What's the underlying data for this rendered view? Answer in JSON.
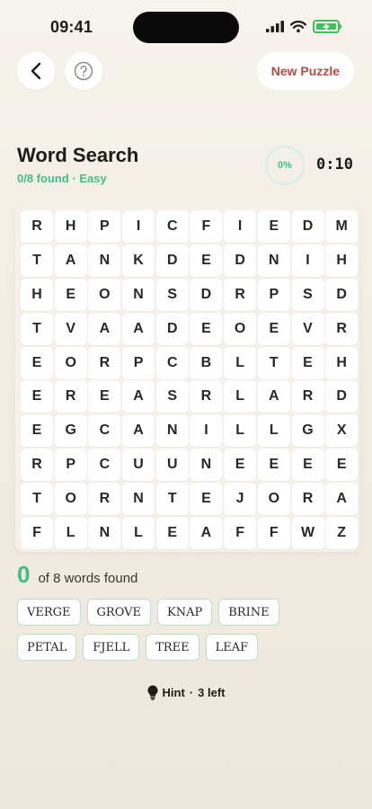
{
  "status": {
    "time": "09:41",
    "battery_level": 1.0
  },
  "nav": {
    "new_puzzle_label": "New Puzzle"
  },
  "header": {
    "title": "Word Search",
    "found_text": "0/8 found",
    "separator": " · ",
    "difficulty": "Easy",
    "progress_label": "0%",
    "progress_fraction": 0,
    "timer": "0:10"
  },
  "grid": [
    [
      "R",
      "H",
      "P",
      "I",
      "C",
      "F",
      "I",
      "E",
      "D",
      "M"
    ],
    [
      "T",
      "A",
      "N",
      "K",
      "D",
      "E",
      "D",
      "N",
      "I",
      "H"
    ],
    [
      "H",
      "E",
      "O",
      "N",
      "S",
      "D",
      "R",
      "P",
      "S",
      "D"
    ],
    [
      "T",
      "V",
      "A",
      "A",
      "D",
      "E",
      "O",
      "E",
      "V",
      "R"
    ],
    [
      "E",
      "O",
      "R",
      "P",
      "C",
      "B",
      "L",
      "T",
      "E",
      "H"
    ],
    [
      "E",
      "R",
      "E",
      "A",
      "S",
      "R",
      "L",
      "A",
      "R",
      "D"
    ],
    [
      "E",
      "G",
      "C",
      "A",
      "N",
      "I",
      "L",
      "L",
      "G",
      "X"
    ],
    [
      "R",
      "P",
      "C",
      "U",
      "U",
      "N",
      "E",
      "E",
      "E",
      "E"
    ],
    [
      "T",
      "O",
      "R",
      "N",
      "T",
      "E",
      "J",
      "O",
      "R",
      "A"
    ],
    [
      "F",
      "L",
      "N",
      "L",
      "E",
      "A",
      "F",
      "F",
      "W",
      "Z"
    ]
  ],
  "progress": {
    "found_count": "0",
    "label": "of 8 words found"
  },
  "words": [
    "VERGE",
    "GROVE",
    "KNAP",
    "BRINE",
    "PETAL",
    "FJELL",
    "TREE",
    "LEAF"
  ],
  "hint": {
    "label": "Hint",
    "separator": "·",
    "remaining": "3 left"
  },
  "colors": {
    "accent": "#3fbf87",
    "new_puzzle": "#b84a3f",
    "chip_border": "#b7e3cd"
  }
}
